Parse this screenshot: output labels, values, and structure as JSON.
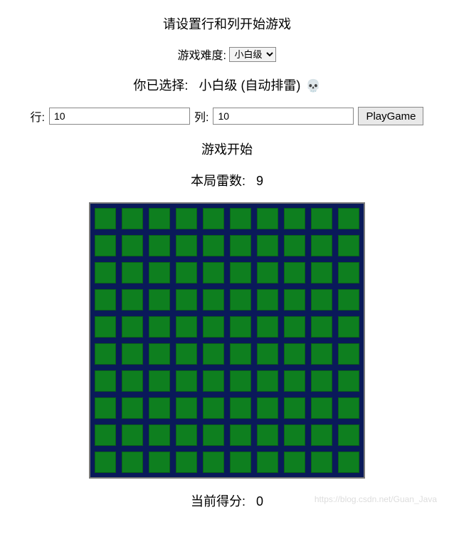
{
  "header": {
    "title": "请设置行和列开始游戏",
    "difficulty_label": "游戏难度:",
    "difficulty_selected": "小白级",
    "chosen_prefix": "你已选择:",
    "chosen_value": "小白级 (自动排雷)",
    "skull": "💀"
  },
  "inputs": {
    "rows_label": "行:",
    "rows_value": "10",
    "cols_label": "列:",
    "cols_value": "10",
    "play_label": "PlayGame"
  },
  "status": {
    "game_start": "游戏开始",
    "mines_label": "本局雷数:",
    "mines_count": "9",
    "score_label": "当前得分:",
    "score_value": "0"
  },
  "board": {
    "rows": 10,
    "cols": 10
  },
  "watermark": "https://blog.csdn.net/Guan_Java"
}
